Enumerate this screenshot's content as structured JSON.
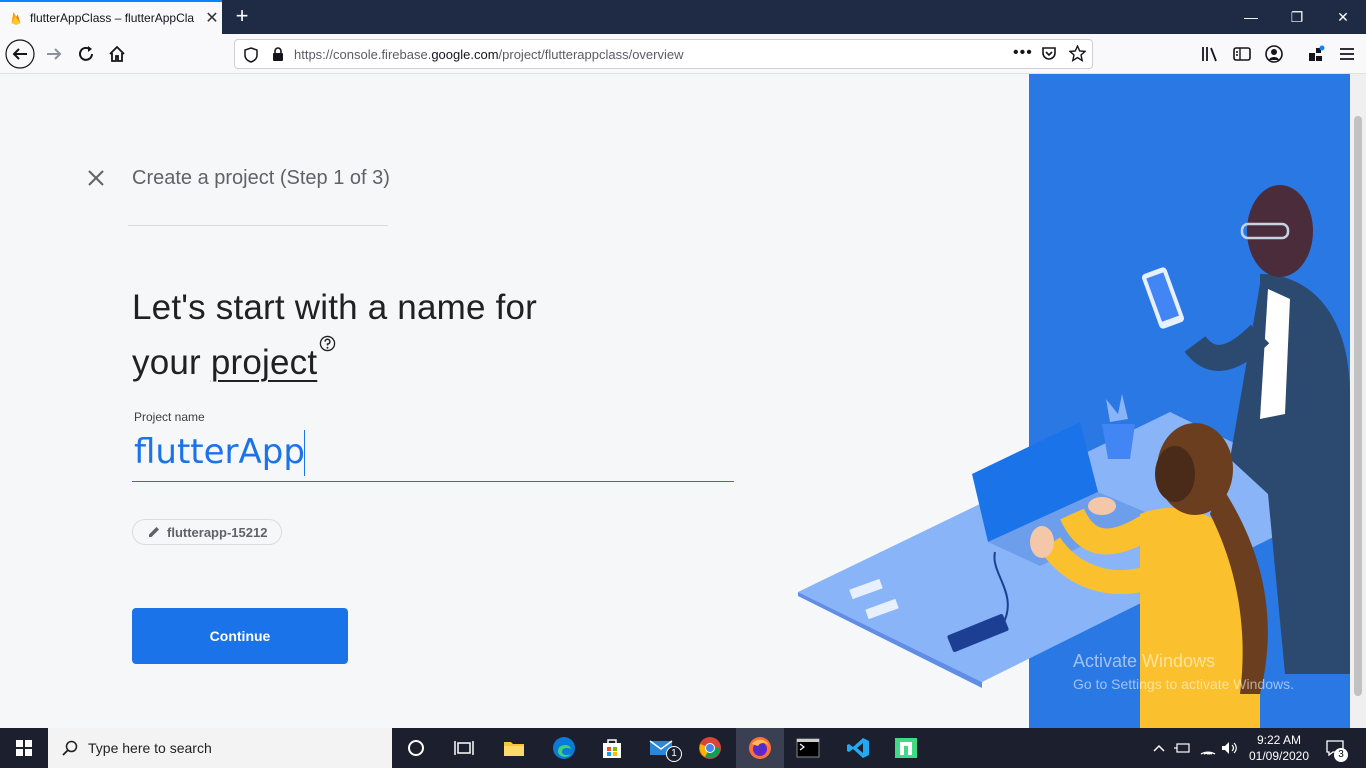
{
  "browser": {
    "tab_title": "flutterAppClass – flutterAppCla",
    "url_prefix": "https://console.firebase.",
    "url_domain": "google.com",
    "url_path": "/project/flutterappclass/overview"
  },
  "dialog": {
    "step_title": "Create a project (Step 1 of 3)",
    "heading_line1": "Let's start with a name for",
    "heading_line2_pre": "your ",
    "heading_line2_link": "project",
    "field_label": "Project name",
    "project_name": "flutterApp",
    "project_id": "flutterapp-15212",
    "continue_label": "Continue"
  },
  "watermark": {
    "line1": "Activate Windows",
    "line2": "Go to Settings to activate Windows."
  },
  "taskbar": {
    "search_placeholder": "Type here to search",
    "mail_badge": "1",
    "time": "9:22 AM",
    "date": "01/09/2020",
    "notification_count": "3"
  },
  "colors": {
    "accent": "#1a73e8",
    "illustration_bg": "#2a78e4",
    "titlebar": "#1f2a44"
  }
}
